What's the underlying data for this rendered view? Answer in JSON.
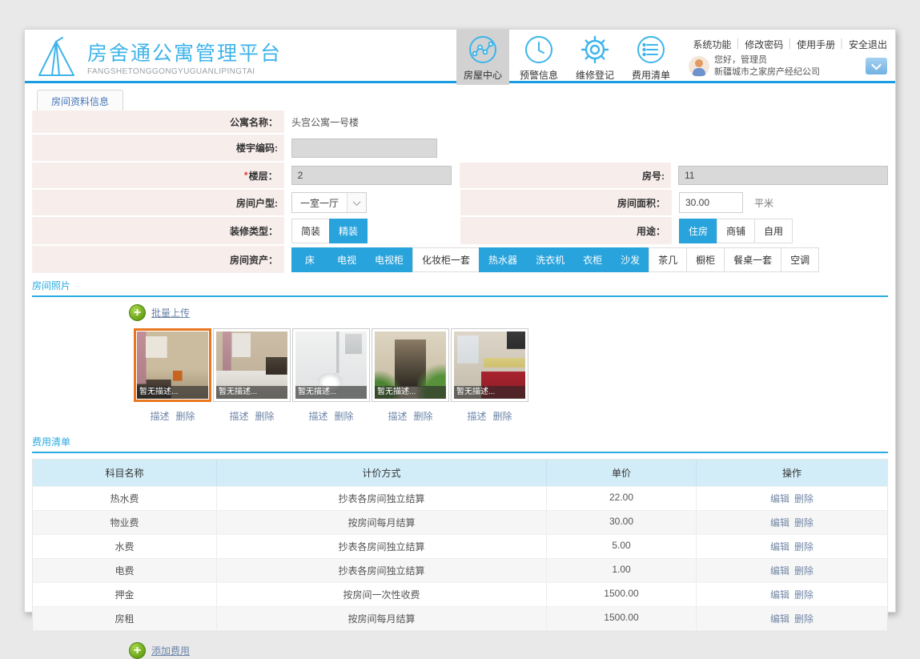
{
  "header": {
    "logo_title": "房舍通公寓管理平台",
    "logo_subtitle": "FANGSHETONGGONGYUGUANLIPINGTAI",
    "nav": [
      {
        "label": "房屋中心",
        "icon": "chart-circle-icon",
        "active": true
      },
      {
        "label": "预警信息",
        "icon": "clock-icon",
        "active": false
      },
      {
        "label": "维修登记",
        "icon": "gear-icon",
        "active": false
      },
      {
        "label": "费用清单",
        "icon": "list-circle-icon",
        "active": false
      }
    ],
    "top_links": [
      "系统功能",
      "修改密码",
      "使用手册",
      "安全退出"
    ],
    "greeting": "您好，管理员",
    "company": "新疆城市之家房产经纪公司"
  },
  "tab": {
    "label": "房间资料信息"
  },
  "form": {
    "apartment_name": {
      "label": "公寓名称：",
      "value": "头宫公寓一号楼"
    },
    "building_code": {
      "label": "楼宇编码:",
      "value": ""
    },
    "floor": {
      "label": "楼层：",
      "required_mark": "*",
      "value": "2"
    },
    "room_no": {
      "label": "房号:",
      "value": "11"
    },
    "room_type": {
      "label": "房间户型:",
      "value": "一室一厅"
    },
    "room_area": {
      "label": "房间面积：",
      "value": "30.00",
      "unit": "平米"
    },
    "decoration": {
      "label": "装修类型：",
      "options": [
        {
          "label": "简装",
          "selected": false
        },
        {
          "label": "精装",
          "selected": true
        }
      ]
    },
    "usage": {
      "label": "用途：",
      "options": [
        {
          "label": "住房",
          "selected": true
        },
        {
          "label": "商铺",
          "selected": false
        },
        {
          "label": "自用",
          "selected": false
        }
      ]
    },
    "assets": {
      "label": "房间资产：",
      "options": [
        {
          "label": "床",
          "selected": true
        },
        {
          "label": "电视",
          "selected": true
        },
        {
          "label": "电视柜",
          "selected": true
        },
        {
          "label": "化妆柜一套",
          "selected": false
        },
        {
          "label": "热水器",
          "selected": true
        },
        {
          "label": "洗衣机",
          "selected": true
        },
        {
          "label": "衣柜",
          "selected": true
        },
        {
          "label": "沙发",
          "selected": true
        },
        {
          "label": "茶几",
          "selected": false
        },
        {
          "label": "橱柜",
          "selected": false
        },
        {
          "label": "餐桌一套",
          "selected": false
        },
        {
          "label": "空调",
          "selected": false
        }
      ]
    }
  },
  "photos": {
    "section_title": "房间照片",
    "upload_label": "批量上传",
    "desc_link": "描述",
    "delete_link": "删除",
    "items": [
      {
        "caption": "暂无描述...",
        "name": "living-room-photo",
        "selected": true
      },
      {
        "caption": "暂无描述...",
        "name": "empty-room-photo",
        "selected": false
      },
      {
        "caption": "暂无描述...",
        "name": "bathroom-photo",
        "selected": false
      },
      {
        "caption": "暂无描述...",
        "name": "hallway-photo",
        "selected": false
      },
      {
        "caption": "暂无描述...",
        "name": "kitchen-photo",
        "selected": false
      }
    ]
  },
  "fees": {
    "section_title": "费用清单",
    "add_label": "添加费用",
    "edit_label": "编辑",
    "delete_label": "删除",
    "columns": [
      "科目名称",
      "计价方式",
      "单价",
      "操作"
    ],
    "rows": [
      {
        "name": "热水费",
        "method": "抄表各房间独立结算",
        "price": "22.00"
      },
      {
        "name": "物业费",
        "method": "按房间每月结算",
        "price": "30.00"
      },
      {
        "name": "水费",
        "method": "抄表各房间独立结算",
        "price": "5.00"
      },
      {
        "name": "电费",
        "method": "抄表各房间独立结算",
        "price": "1.00"
      },
      {
        "name": "押金",
        "method": "按房间一次性收费",
        "price": "1500.00"
      },
      {
        "name": "房租",
        "method": "按房间每月结算",
        "price": "1500.00"
      }
    ]
  },
  "colors": {
    "accent_blue": "#29abe2",
    "active_button_blue": "#29a3dc",
    "header_line_blue": "#1b9ce0",
    "label_bg_pink": "#f7eeec",
    "table_header_blue": "#d2edf8",
    "selected_photo_orange": "#e8761e",
    "add_icon_green": "#649f16"
  }
}
